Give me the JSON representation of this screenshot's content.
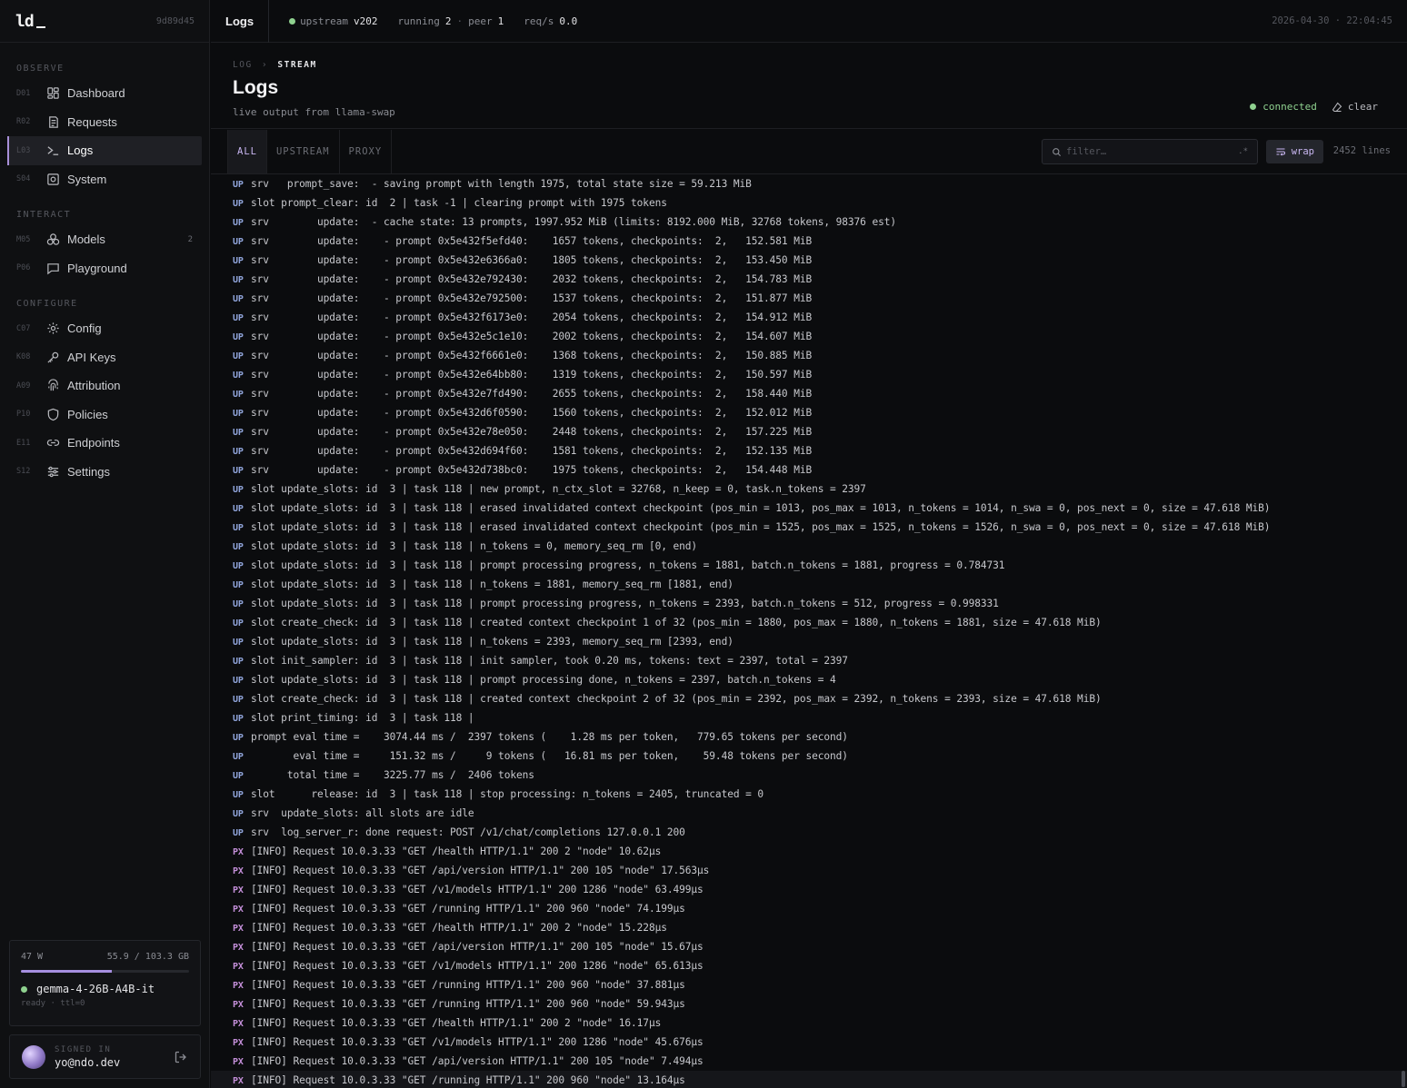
{
  "brand": {
    "logo": "ld",
    "build": "9d89d45"
  },
  "sidebar": {
    "sections": [
      {
        "label": "OBSERVE",
        "items": [
          {
            "code": "D01",
            "label": "Dashboard",
            "icon": "dashboard-icon"
          },
          {
            "code": "R02",
            "label": "Requests",
            "icon": "requests-icon"
          },
          {
            "code": "L03",
            "label": "Logs",
            "icon": "terminal-icon",
            "active": true
          },
          {
            "code": "S04",
            "label": "System",
            "icon": "system-icon"
          }
        ]
      },
      {
        "label": "INTERACT",
        "items": [
          {
            "code": "M05",
            "label": "Models",
            "icon": "models-icon",
            "badge": "2"
          },
          {
            "code": "P06",
            "label": "Playground",
            "icon": "chat-icon"
          }
        ]
      },
      {
        "label": "CONFIGURE",
        "items": [
          {
            "code": "C07",
            "label": "Config",
            "icon": "gear-icon"
          },
          {
            "code": "K08",
            "label": "API Keys",
            "icon": "key-icon"
          },
          {
            "code": "A09",
            "label": "Attribution",
            "icon": "fingerprint-icon"
          },
          {
            "code": "P10",
            "label": "Policies",
            "icon": "shield-icon"
          },
          {
            "code": "E11",
            "label": "Endpoints",
            "icon": "link-icon"
          },
          {
            "code": "S12",
            "label": "Settings",
            "icon": "sliders-icon"
          }
        ]
      }
    ]
  },
  "status": {
    "power": "47 W",
    "memory": "55.9 / 103.3 GB",
    "memory_fraction": 0.54,
    "model": "gemma-4-26B-A4B-it",
    "model_sub": "ready · ttl=0"
  },
  "user": {
    "label": "SIGNED IN",
    "email": "yo@ndo.dev"
  },
  "topbar": {
    "title": "Logs",
    "upstream_label": "upstream",
    "upstream_value": "v202",
    "running_label": "running",
    "running_value": "2",
    "peer_label": "peer",
    "peer_value": "1",
    "reqs_label": "req/s",
    "reqs_value": "0.0",
    "timestamp": "2026-04-30 · 22:04:45"
  },
  "header": {
    "crumb_parent": "LOG",
    "crumb_current": "STREAM",
    "title": "Logs",
    "subtitle": "live output from llama-swap",
    "connection": "connected",
    "clear_label": "clear"
  },
  "toolbar": {
    "tabs": [
      "ALL",
      "UPSTREAM",
      "PROXY"
    ],
    "filter_placeholder": "filter…",
    "regex_label": ".*",
    "wrap_label": "wrap",
    "line_count": "2452 lines"
  },
  "colors": {
    "accent": "#a88fd8",
    "connected": "#8fd18f",
    "up_tag": "#8fa3d9",
    "px_tag": "#c48fd9"
  },
  "logs": [
    {
      "src": "UP",
      "text": "srv   prompt_save:  - saving prompt with length 1975, total state size = 59.213 MiB"
    },
    {
      "src": "UP",
      "text": "slot prompt_clear: id  2 | task -1 | clearing prompt with 1975 tokens"
    },
    {
      "src": "UP",
      "text": "srv        update:  - cache state: 13 prompts, 1997.952 MiB (limits: 8192.000 MiB, 32768 tokens, 98376 est)"
    },
    {
      "src": "UP",
      "text": "srv        update:    - prompt 0x5e432f5efd40:    1657 tokens, checkpoints:  2,   152.581 MiB"
    },
    {
      "src": "UP",
      "text": "srv        update:    - prompt 0x5e432e6366a0:    1805 tokens, checkpoints:  2,   153.450 MiB"
    },
    {
      "src": "UP",
      "text": "srv        update:    - prompt 0x5e432e792430:    2032 tokens, checkpoints:  2,   154.783 MiB"
    },
    {
      "src": "UP",
      "text": "srv        update:    - prompt 0x5e432e792500:    1537 tokens, checkpoints:  2,   151.877 MiB"
    },
    {
      "src": "UP",
      "text": "srv        update:    - prompt 0x5e432f6173e0:    2054 tokens, checkpoints:  2,   154.912 MiB"
    },
    {
      "src": "UP",
      "text": "srv        update:    - prompt 0x5e432e5c1e10:    2002 tokens, checkpoints:  2,   154.607 MiB"
    },
    {
      "src": "UP",
      "text": "srv        update:    - prompt 0x5e432f6661e0:    1368 tokens, checkpoints:  2,   150.885 MiB"
    },
    {
      "src": "UP",
      "text": "srv        update:    - prompt 0x5e432e64bb80:    1319 tokens, checkpoints:  2,   150.597 MiB"
    },
    {
      "src": "UP",
      "text": "srv        update:    - prompt 0x5e432e7fd490:    2655 tokens, checkpoints:  2,   158.440 MiB"
    },
    {
      "src": "UP",
      "text": "srv        update:    - prompt 0x5e432d6f0590:    1560 tokens, checkpoints:  2,   152.012 MiB"
    },
    {
      "src": "UP",
      "text": "srv        update:    - prompt 0x5e432e78e050:    2448 tokens, checkpoints:  2,   157.225 MiB"
    },
    {
      "src": "UP",
      "text": "srv        update:    - prompt 0x5e432d694f60:    1581 tokens, checkpoints:  2,   152.135 MiB"
    },
    {
      "src": "UP",
      "text": "srv        update:    - prompt 0x5e432d738bc0:    1975 tokens, checkpoints:  2,   154.448 MiB"
    },
    {
      "src": "UP",
      "text": "slot update_slots: id  3 | task 118 | new prompt, n_ctx_slot = 32768, n_keep = 0, task.n_tokens = 2397"
    },
    {
      "src": "UP",
      "text": "slot update_slots: id  3 | task 118 | erased invalidated context checkpoint (pos_min = 1013, pos_max = 1013, n_tokens = 1014, n_swa = 0, pos_next = 0, size = 47.618 MiB)"
    },
    {
      "src": "UP",
      "text": "slot update_slots: id  3 | task 118 | erased invalidated context checkpoint (pos_min = 1525, pos_max = 1525, n_tokens = 1526, n_swa = 0, pos_next = 0, size = 47.618 MiB)"
    },
    {
      "src": "UP",
      "text": "slot update_slots: id  3 | task 118 | n_tokens = 0, memory_seq_rm [0, end)"
    },
    {
      "src": "UP",
      "text": "slot update_slots: id  3 | task 118 | prompt processing progress, n_tokens = 1881, batch.n_tokens = 1881, progress = 0.784731"
    },
    {
      "src": "UP",
      "text": "slot update_slots: id  3 | task 118 | n_tokens = 1881, memory_seq_rm [1881, end)"
    },
    {
      "src": "UP",
      "text": "slot update_slots: id  3 | task 118 | prompt processing progress, n_tokens = 2393, batch.n_tokens = 512, progress = 0.998331"
    },
    {
      "src": "UP",
      "text": "slot create_check: id  3 | task 118 | created context checkpoint 1 of 32 (pos_min = 1880, pos_max = 1880, n_tokens = 1881, size = 47.618 MiB)"
    },
    {
      "src": "UP",
      "text": "slot update_slots: id  3 | task 118 | n_tokens = 2393, memory_seq_rm [2393, end)"
    },
    {
      "src": "UP",
      "text": "slot init_sampler: id  3 | task 118 | init sampler, took 0.20 ms, tokens: text = 2397, total = 2397"
    },
    {
      "src": "UP",
      "text": "slot update_slots: id  3 | task 118 | prompt processing done, n_tokens = 2397, batch.n_tokens = 4"
    },
    {
      "src": "UP",
      "text": "slot create_check: id  3 | task 118 | created context checkpoint 2 of 32 (pos_min = 2392, pos_max = 2392, n_tokens = 2393, size = 47.618 MiB)"
    },
    {
      "src": "UP",
      "text": "slot print_timing: id  3 | task 118 |"
    },
    {
      "src": "UP",
      "text": "prompt eval time =    3074.44 ms /  2397 tokens (    1.28 ms per token,   779.65 tokens per second)"
    },
    {
      "src": "UP",
      "text": "       eval time =     151.32 ms /     9 tokens (   16.81 ms per token,    59.48 tokens per second)"
    },
    {
      "src": "UP",
      "text": "      total time =    3225.77 ms /  2406 tokens"
    },
    {
      "src": "UP",
      "text": "slot      release: id  3 | task 118 | stop processing: n_tokens = 2405, truncated = 0"
    },
    {
      "src": "UP",
      "text": "srv  update_slots: all slots are idle"
    },
    {
      "src": "UP",
      "text": "srv  log_server_r: done request: POST /v1/chat/completions 127.0.0.1 200"
    },
    {
      "src": "PX",
      "text": "[INFO] Request 10.0.3.33 \"GET /health HTTP/1.1\" 200 2 \"node\" 10.62µs"
    },
    {
      "src": "PX",
      "text": "[INFO] Request 10.0.3.33 \"GET /api/version HTTP/1.1\" 200 105 \"node\" 17.563µs"
    },
    {
      "src": "PX",
      "text": "[INFO] Request 10.0.3.33 \"GET /v1/models HTTP/1.1\" 200 1286 \"node\" 63.499µs"
    },
    {
      "src": "PX",
      "text": "[INFO] Request 10.0.3.33 \"GET /running HTTP/1.1\" 200 960 \"node\" 74.199µs"
    },
    {
      "src": "PX",
      "text": "[INFO] Request 10.0.3.33 \"GET /health HTTP/1.1\" 200 2 \"node\" 15.228µs"
    },
    {
      "src": "PX",
      "text": "[INFO] Request 10.0.3.33 \"GET /api/version HTTP/1.1\" 200 105 \"node\" 15.67µs"
    },
    {
      "src": "PX",
      "text": "[INFO] Request 10.0.3.33 \"GET /v1/models HTTP/1.1\" 200 1286 \"node\" 65.613µs"
    },
    {
      "src": "PX",
      "text": "[INFO] Request 10.0.3.33 \"GET /running HTTP/1.1\" 200 960 \"node\" 37.881µs"
    },
    {
      "src": "PX",
      "text": "[INFO] Request 10.0.3.33 \"GET /running HTTP/1.1\" 200 960 \"node\" 59.943µs"
    },
    {
      "src": "PX",
      "text": "[INFO] Request 10.0.3.33 \"GET /health HTTP/1.1\" 200 2 \"node\" 16.17µs"
    },
    {
      "src": "PX",
      "text": "[INFO] Request 10.0.3.33 \"GET /v1/models HTTP/1.1\" 200 1286 \"node\" 45.676µs"
    },
    {
      "src": "PX",
      "text": "[INFO] Request 10.0.3.33 \"GET /api/version HTTP/1.1\" 200 105 \"node\" 7.494µs"
    },
    {
      "src": "PX",
      "text": "[INFO] Request 10.0.3.33 \"GET /running HTTP/1.1\" 200 960 \"node\" 13.164µs"
    }
  ]
}
